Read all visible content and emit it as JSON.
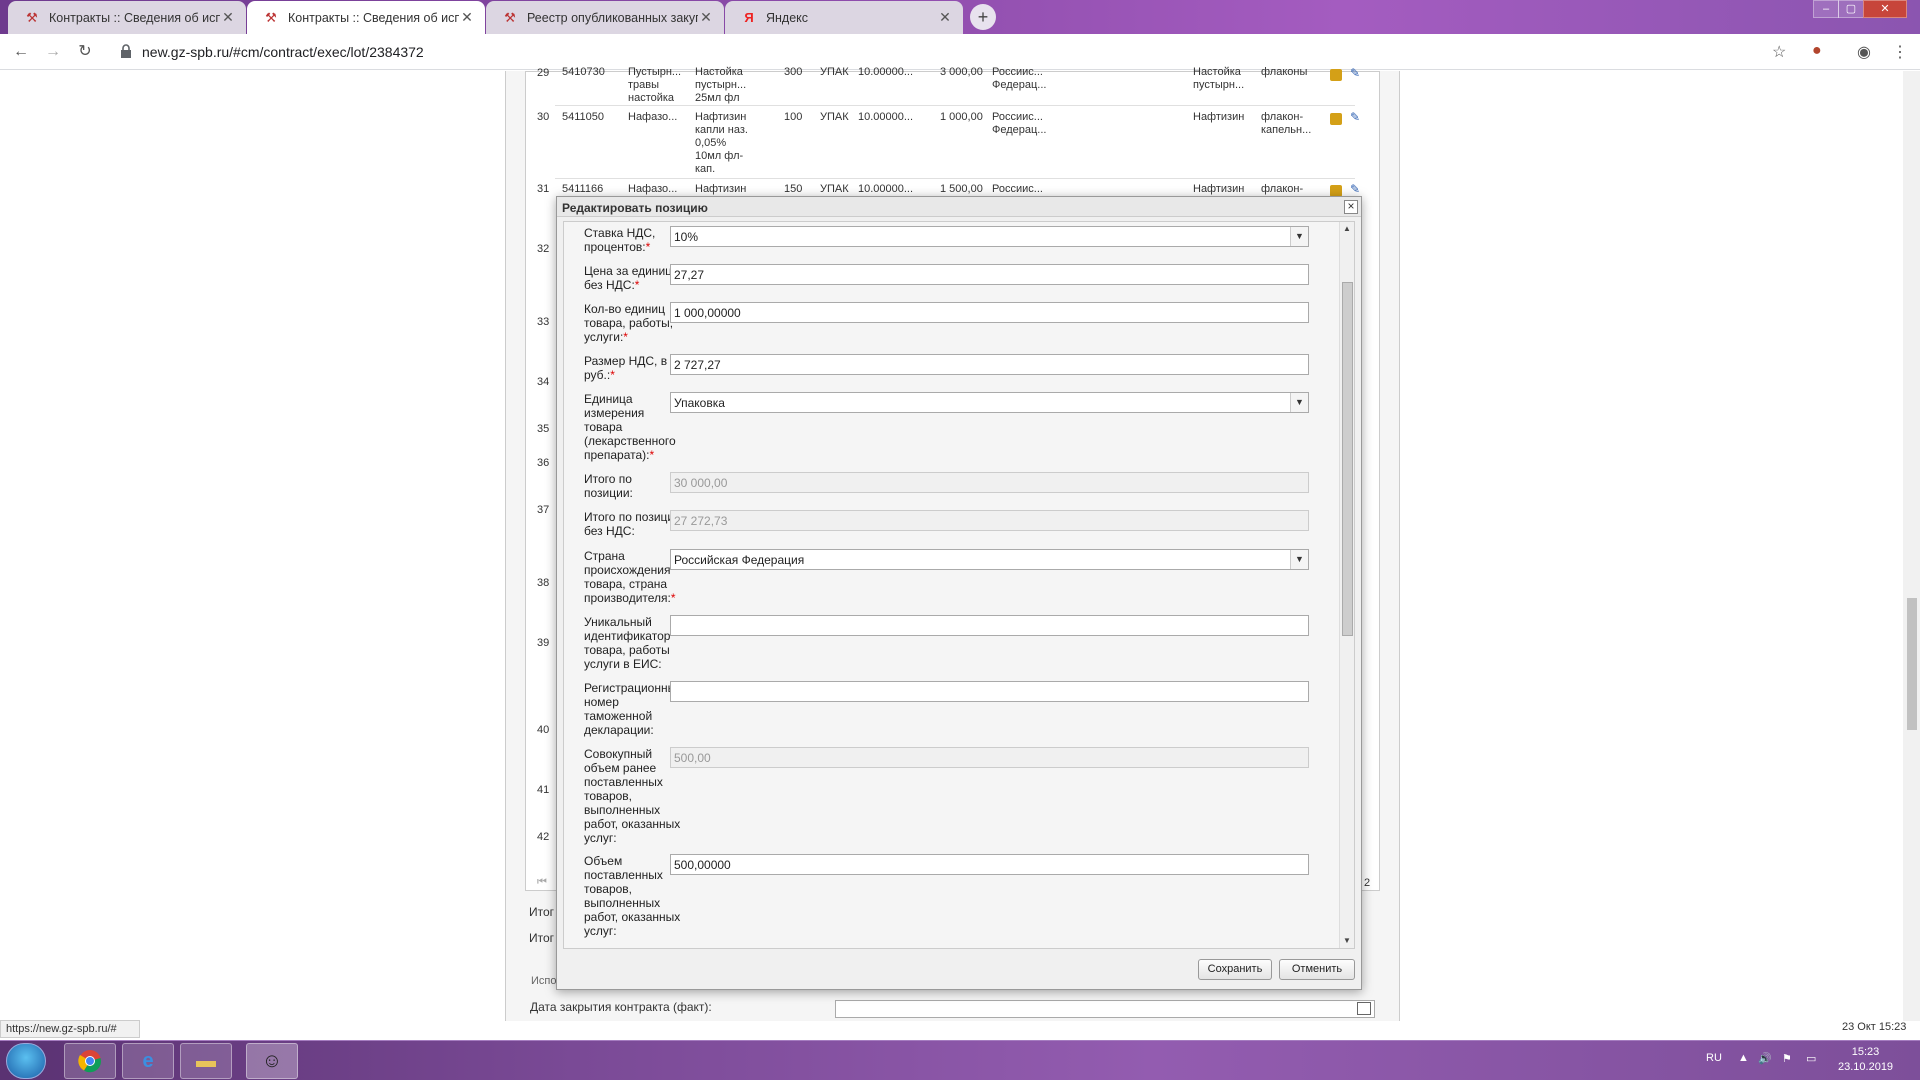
{
  "browser": {
    "tabs": [
      {
        "title": "Контракты :: Сведения об испо",
        "active": false,
        "icon": "tool-icon"
      },
      {
        "title": "Контракты :: Сведения об испо",
        "active": true,
        "icon": "tool-icon"
      },
      {
        "title": "Реестр опубликованных закупо",
        "active": false,
        "icon": "tool-icon"
      },
      {
        "title": "Яндекс",
        "active": false,
        "icon": "yandex-icon"
      }
    ],
    "url": "new.gz-spb.ru/#cm/contract/exec/lot/2384372"
  },
  "table": {
    "rows": [
      {
        "num": "29",
        "code": "5410730",
        "name": "Пустырн... травы настойка",
        "desc": "Настойка пустырн... 25мл фл",
        "qty": "300",
        "unit": "УПАК",
        "price": "10.00000...",
        "sum": "3 000,00",
        "country": "Россиис... Федерац...",
        "trade": "Настойка пустырн...",
        "form": "флаконы"
      },
      {
        "num": "30",
        "code": "5411050",
        "name": "Нафазо...",
        "desc": "Нафтизин капли наз. 0,05% 10мл фл-кап.",
        "qty": "100",
        "unit": "УПАК",
        "price": "10.00000...",
        "sum": "1 000,00",
        "country": "Россиис... Федерац...",
        "trade": "Нафтизин",
        "form": "флакон-капельн..."
      },
      {
        "num": "31",
        "code": "5411166",
        "name": "Нафазо...",
        "desc": "Нафтизин",
        "qty": "150",
        "unit": "УПАК",
        "price": "10.00000...",
        "sum": "1 500,00",
        "country": "Россиис...",
        "trade": "Нафтизин",
        "form": "флакон-"
      }
    ],
    "row_numbers_below": [
      "32",
      "33",
      "34",
      "35",
      "36",
      "37",
      "38",
      "39",
      "40",
      "41",
      "42"
    ],
    "pager_page": "2",
    "totals_label_1": "Итог",
    "totals_label_2": "Итог",
    "section_label": "Испо",
    "close_date_label": "Дата закрытия контракта (факт):"
  },
  "modal": {
    "title": "Редактировать позицию",
    "fields": [
      {
        "label": "Ставка НДС, процентов:",
        "required": true,
        "type": "select",
        "value": "10%"
      },
      {
        "label": "Цена за единицу без НДС:",
        "required": true,
        "type": "input",
        "value": "27,27"
      },
      {
        "label": "Кол-во единиц товара, работы, услуги:",
        "required": true,
        "type": "input",
        "value": "1 000,00000"
      },
      {
        "label": "Размер НДС, в руб.:",
        "required": true,
        "type": "input",
        "value": "2 727,27"
      },
      {
        "label": "Единица измерения товара (лекарственного препарата):",
        "required": true,
        "type": "select",
        "value": "Упаковка"
      },
      {
        "label": "Итого по позиции:",
        "required": false,
        "type": "disabled",
        "value": "30 000,00"
      },
      {
        "label": "Итого по позиции без НДС:",
        "required": false,
        "type": "disabled",
        "value": "27 272,73"
      },
      {
        "label": "Страна происхождения товара, страна производителя:",
        "required": true,
        "type": "select",
        "value": "Российская Федерация"
      },
      {
        "label": "Уникальный идентификатор товара, работы услуги в ЕИС:",
        "required": false,
        "type": "input",
        "value": ""
      },
      {
        "label": "Регистрационный номер таможенной декларации:",
        "required": false,
        "type": "input",
        "value": ""
      },
      {
        "label": "Совокупный объем ранее поставленных товаров, выполненных работ, оказанных услуг:",
        "required": false,
        "type": "disabled",
        "value": "500,00"
      },
      {
        "label": "Объем поставленных товаров, выполненных работ, оказанных услуг:",
        "required": false,
        "type": "input",
        "value": "500,00000"
      }
    ],
    "save_label": "Сохранить",
    "cancel_label": "Отменить"
  },
  "status_url": "https://new.gz-spb.ru/#",
  "page_date": "23 Окт 15:23",
  "taskbar": {
    "lang": "RU",
    "time": "15:23",
    "date": "23.10.2019"
  }
}
